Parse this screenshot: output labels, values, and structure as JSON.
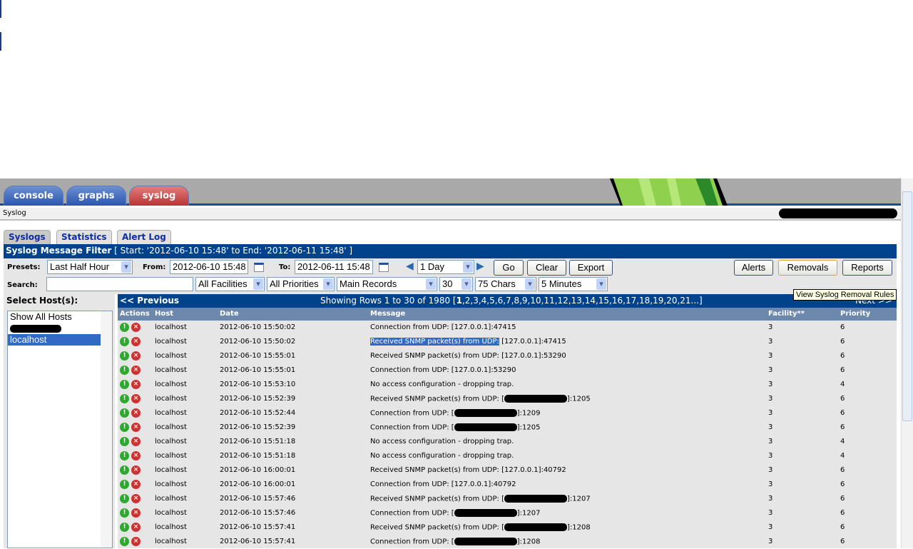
{
  "main_tabs": [
    {
      "label": "console"
    },
    {
      "label": "graphs"
    },
    {
      "label": "syslog"
    }
  ],
  "breadcrumb": "Syslog",
  "sub_tabs": [
    {
      "label": "Syslogs"
    },
    {
      "label": "Statistics"
    },
    {
      "label": "Alert Log"
    }
  ],
  "filter": {
    "title": "Syslog Message Filter",
    "range": " [ Start: '2012-06-10 15:48' to End: '2012-06-11 15:48' ]",
    "presets_label": "Presets:",
    "preset": "Last Half Hour",
    "from_label": "From:",
    "from": "2012-06-10 15:48",
    "to_label": "To:",
    "to": "2012-06-11 15:48",
    "span": "1 Day",
    "go": "Go",
    "clear": "Clear",
    "export": "Export",
    "alerts": "Alerts",
    "removals": "Removals",
    "reports": "Reports",
    "search_label": "Search:",
    "search_value": "",
    "facilities": "All Facilities",
    "priorities": "All Priorities",
    "records": "Main Records",
    "rows": "30",
    "chars": "75 Chars",
    "refresh": "5 Minutes"
  },
  "tooltip": "View Syslog Removal Rules",
  "hosts": {
    "label": "Select Host(s):",
    "items": [
      "Show All Hosts",
      "localhost"
    ],
    "selected": "localhost"
  },
  "nav": {
    "previous": "<< Previous",
    "showing": "Showing Rows 1 to 30 of 1980 [",
    "current_page": "1",
    "pages": ",2,3,4,5,6,7,8,9,10,11,12,13,14,15,16,17,18,19,20,21...]",
    "next": "Next >>"
  },
  "columns": [
    "Actions",
    "Host",
    "Date",
    "Message",
    "Facility**",
    "Priority"
  ],
  "rows": [
    {
      "host": "localhost",
      "date": "2012-06-10 15:50:02",
      "msg": "Connection from UDP: [127.0.0.1]:47415",
      "facility": "3",
      "priority": "6"
    },
    {
      "host": "localhost",
      "date": "2012-06-10 15:50:02",
      "msg_hl": "Received SNMP packet(s) from UDP:",
      "msg": " [127.0.0.1]:47415",
      "facility": "3",
      "priority": "6"
    },
    {
      "host": "localhost",
      "date": "2012-06-10 15:55:01",
      "msg": "Received SNMP packet(s) from UDP: [127.0.0.1]:53290",
      "facility": "3",
      "priority": "6"
    },
    {
      "host": "localhost",
      "date": "2012-06-10 15:55:01",
      "msg": "Connection from UDP: [127.0.0.1]:53290",
      "facility": "3",
      "priority": "6"
    },
    {
      "host": "localhost",
      "date": "2012-06-10 15:53:10",
      "msg": "No access configuration - dropping trap.",
      "facility": "3",
      "priority": "4"
    },
    {
      "host": "localhost",
      "date": "2012-06-10 15:52:39",
      "msg": "Received SNMP packet(s) from UDP: [",
      "msg_after": "]:1205",
      "redacted": true,
      "facility": "3",
      "priority": "6"
    },
    {
      "host": "localhost",
      "date": "2012-06-10 15:52:44",
      "msg": "Connection from UDP: [",
      "msg_after": "]:1209",
      "redacted": true,
      "facility": "3",
      "priority": "6"
    },
    {
      "host": "localhost",
      "date": "2012-06-10 15:52:39",
      "msg": "Connection from UDP: [",
      "msg_after": "]:1205",
      "redacted": true,
      "facility": "3",
      "priority": "6"
    },
    {
      "host": "localhost",
      "date": "2012-06-10 15:51:18",
      "msg": "No access configuration - dropping trap.",
      "facility": "3",
      "priority": "4"
    },
    {
      "host": "localhost",
      "date": "2012-06-10 15:51:18",
      "msg": "No access configuration - dropping trap.",
      "facility": "3",
      "priority": "4"
    },
    {
      "host": "localhost",
      "date": "2012-06-10 16:00:01",
      "msg": "Received SNMP packet(s) from UDP: [127.0.0.1]:40792",
      "facility": "3",
      "priority": "6"
    },
    {
      "host": "localhost",
      "date": "2012-06-10 16:00:01",
      "msg": "Connection from UDP: [127.0.0.1]:40792",
      "facility": "3",
      "priority": "6"
    },
    {
      "host": "localhost",
      "date": "2012-06-10 15:57:46",
      "msg": "Received SNMP packet(s) from UDP: [",
      "msg_after": "]:1207",
      "redacted": true,
      "facility": "3",
      "priority": "6"
    },
    {
      "host": "localhost",
      "date": "2012-06-10 15:57:46",
      "msg": "Connection from UDP: [",
      "msg_after": "]:1207",
      "redacted": true,
      "facility": "3",
      "priority": "6"
    },
    {
      "host": "localhost",
      "date": "2012-06-10 15:57:41",
      "msg": "Received SNMP packet(s) from UDP: [",
      "msg_after": "]:1208",
      "redacted": true,
      "facility": "3",
      "priority": "6"
    },
    {
      "host": "localhost",
      "date": "2012-06-10 15:57:41",
      "msg": "Connection from UDP: [",
      "msg_after": "]:1208",
      "redacted": true,
      "facility": "3",
      "priority": "6"
    }
  ],
  "colors": {
    "header_blue": "#00438c",
    "column_header": "#6d88ad",
    "syslog_tab": "#b93434",
    "selection": "#316ac5"
  }
}
